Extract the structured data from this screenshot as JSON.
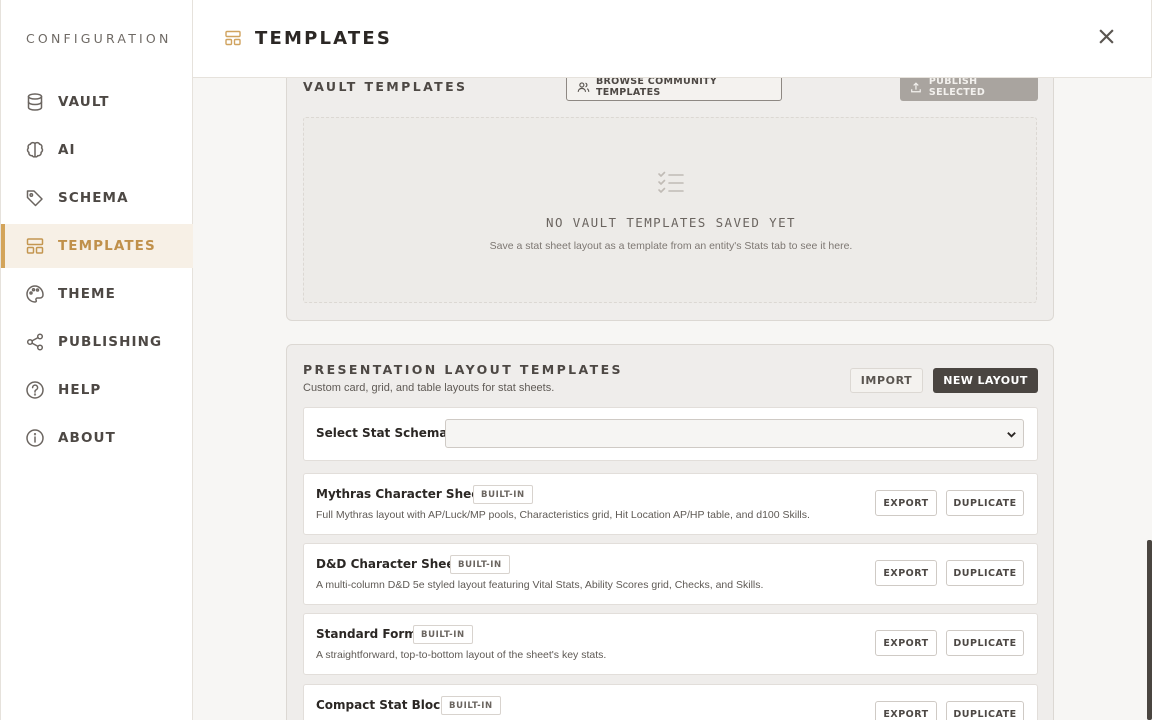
{
  "sidebar": {
    "title": "CONFIGURATION",
    "items": [
      {
        "label": "VAULT",
        "icon": "database-icon"
      },
      {
        "label": "AI",
        "icon": "brain-icon"
      },
      {
        "label": "SCHEMA",
        "icon": "tag-icon"
      },
      {
        "label": "TEMPLATES",
        "icon": "layout-icon",
        "active": true
      },
      {
        "label": "THEME",
        "icon": "palette-icon"
      },
      {
        "label": "PUBLISHING",
        "icon": "share-icon"
      },
      {
        "label": "HELP",
        "icon": "help-circle-icon"
      },
      {
        "label": "ABOUT",
        "icon": "info-circle-icon"
      }
    ]
  },
  "header": {
    "title": "TEMPLATES",
    "icon": "layout-icon",
    "close_icon": "close-icon"
  },
  "vault_templates": {
    "title": "VAULT TEMPLATES",
    "browse_label": "BROWSE COMMUNITY TEMPLATES",
    "publish_label": "PUBLISH SELECTED",
    "empty_icon": "checklist-icon",
    "empty_title": "NO VAULT TEMPLATES SAVED YET",
    "empty_subtitle": "Save a stat sheet layout as a template from an entity's Stats tab to see it here."
  },
  "layout_templates": {
    "title": "PRESENTATION LAYOUT TEMPLATES",
    "description": "Custom card, grid, and table layouts for stat sheets.",
    "import_label": "IMPORT",
    "new_label": "NEW LAYOUT",
    "schema_label": "Select Stat Schema:",
    "schema_value": "",
    "templates": [
      {
        "name": "Mythras Character Sheet",
        "badge": "BUILT-IN",
        "description": "Full Mythras layout with AP/Luck/MP pools, Characteristics grid, Hit Location AP/HP table, and d100 Skills.",
        "export_label": "EXPORT",
        "duplicate_label": "DUPLICATE"
      },
      {
        "name": "D&D Character Sheet",
        "badge": "BUILT-IN",
        "description": "A multi-column D&D 5e styled layout featuring Vital Stats, Ability Scores grid, Checks, and Skills.",
        "export_label": "EXPORT",
        "duplicate_label": "DUPLICATE"
      },
      {
        "name": "Standard Form",
        "badge": "BUILT-IN",
        "description": "A straightforward, top-to-bottom layout of the sheet's key stats.",
        "export_label": "EXPORT",
        "duplicate_label": "DUPLICATE"
      },
      {
        "name": "Compact Stat Block",
        "badge": "BUILT-IN",
        "description": "",
        "export_label": "EXPORT",
        "duplicate_label": "DUPLICATE"
      }
    ]
  },
  "colors": {
    "accent": "#d3a45a",
    "active_bg": "#f7f0e6",
    "primary_button": "#4a4541",
    "disabled_button": "#a9a49f"
  }
}
